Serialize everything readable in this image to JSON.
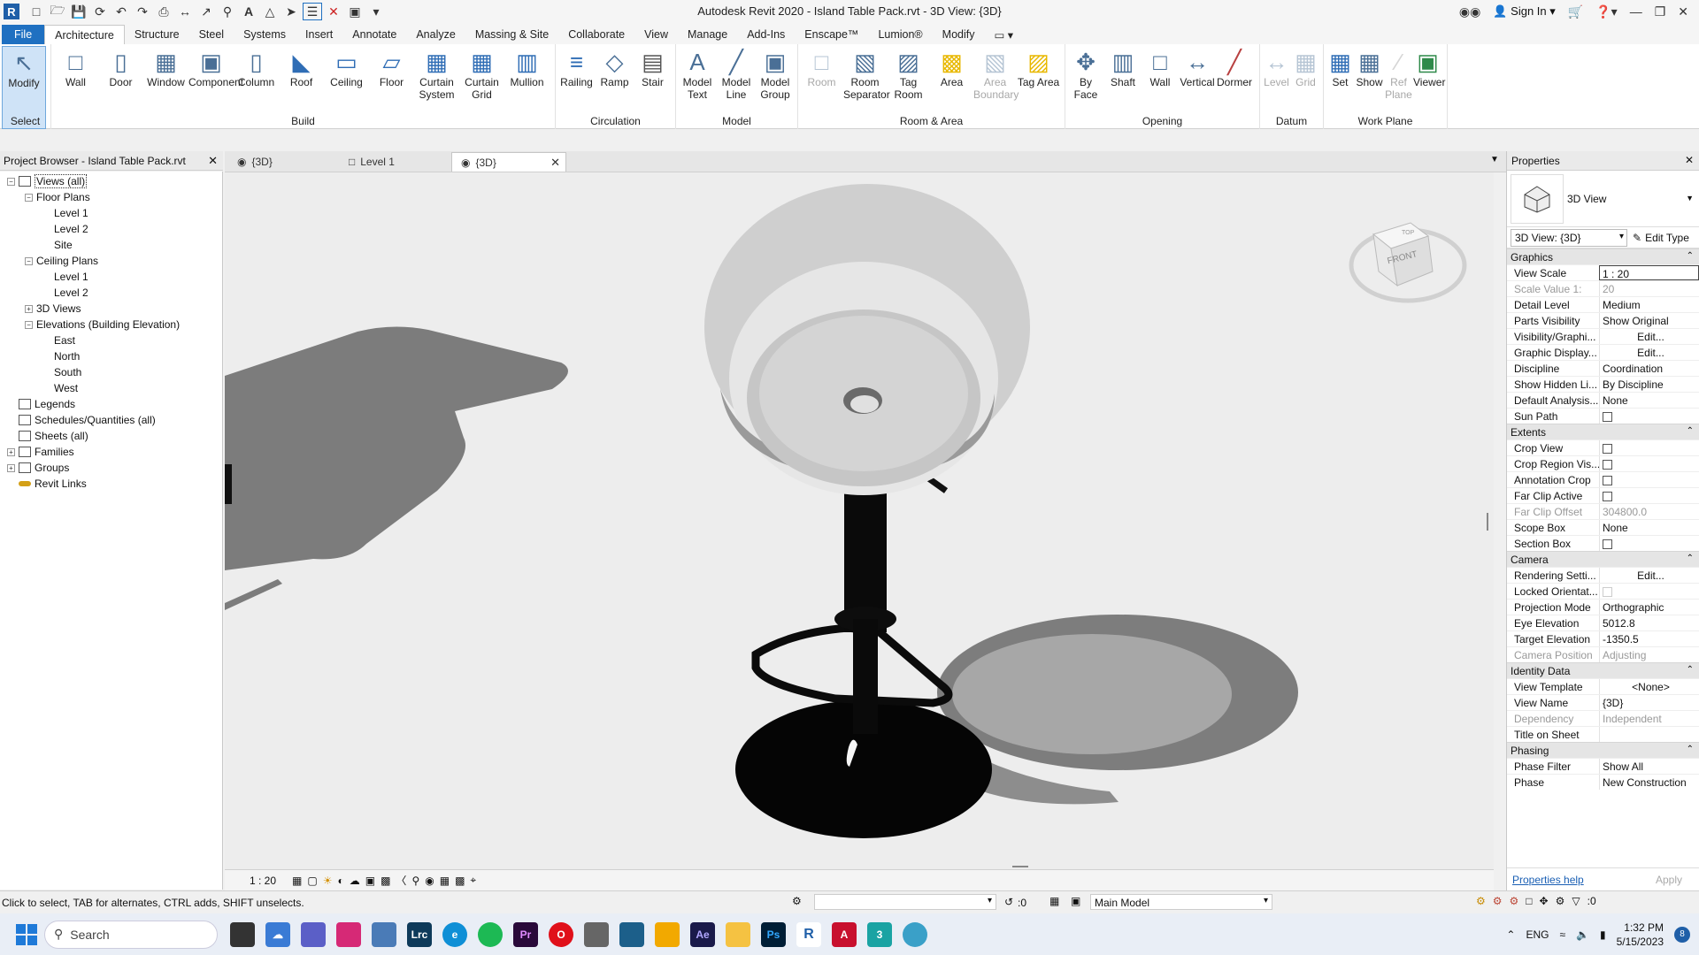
{
  "titlebar": {
    "title": "Autodesk Revit 2020 - Island Table Pack.rvt - 3D View: {3D}",
    "sign_in": "Sign In"
  },
  "menu": {
    "tabs": [
      "File",
      "Architecture",
      "Structure",
      "Steel",
      "Systems",
      "Insert",
      "Annotate",
      "Analyze",
      "Massing & Site",
      "Collaborate",
      "View",
      "Manage",
      "Add-Ins",
      "Enscape™",
      "Lumion®",
      "Modify"
    ]
  },
  "ribbon": {
    "select": {
      "title": "Select",
      "tools": [
        "Modify"
      ]
    },
    "build": {
      "title": "Build",
      "tools": [
        "Wall",
        "Door",
        "Window",
        "Component",
        "Column",
        "Roof",
        "Ceiling",
        "Floor",
        "Curtain System",
        "Curtain Grid",
        "Mullion"
      ]
    },
    "circulation": {
      "title": "Circulation",
      "tools": [
        "Railing",
        "Ramp",
        "Stair"
      ]
    },
    "model": {
      "title": "Model",
      "tools": [
        "Model Text",
        "Model Line",
        "Model Group"
      ]
    },
    "room_area": {
      "title": "Room & Area",
      "tools": [
        "Room",
        "Room Separator",
        "Tag Room",
        "Area",
        "Area Boundary",
        "Tag Area"
      ]
    },
    "opening": {
      "title": "Opening",
      "tools": [
        "By Face",
        "Shaft",
        "Wall",
        "Vertical",
        "Dormer"
      ]
    },
    "datum": {
      "title": "Datum",
      "tools": [
        "Level",
        "Grid"
      ]
    },
    "work_plane": {
      "title": "Work Plane",
      "tools": [
        "Set",
        "Show",
        "Ref Plane",
        "Viewer"
      ]
    }
  },
  "project_browser": {
    "title": "Project Browser - Island Table Pack.rvt",
    "items": [
      {
        "label": "Views (all)",
        "level": 0,
        "exp": "-"
      },
      {
        "label": "Floor Plans",
        "level": 1,
        "exp": "-"
      },
      {
        "label": "Level 1",
        "level": 2,
        "exp": ""
      },
      {
        "label": "Level 2",
        "level": 2,
        "exp": ""
      },
      {
        "label": "Site",
        "level": 2,
        "exp": ""
      },
      {
        "label": "Ceiling Plans",
        "level": 1,
        "exp": "-"
      },
      {
        "label": "Level 1",
        "level": 2,
        "exp": ""
      },
      {
        "label": "Level 2",
        "level": 2,
        "exp": ""
      },
      {
        "label": "3D Views",
        "level": 1,
        "exp": "+"
      },
      {
        "label": "Elevations (Building Elevation)",
        "level": 1,
        "exp": "-"
      },
      {
        "label": "East",
        "level": 2,
        "exp": ""
      },
      {
        "label": "North",
        "level": 2,
        "exp": ""
      },
      {
        "label": "South",
        "level": 2,
        "exp": ""
      },
      {
        "label": "West",
        "level": 2,
        "exp": ""
      },
      {
        "label": "Legends",
        "level": 0,
        "exp": ""
      },
      {
        "label": "Schedules/Quantities (all)",
        "level": 0,
        "exp": ""
      },
      {
        "label": "Sheets (all)",
        "level": 0,
        "exp": ""
      },
      {
        "label": "Families",
        "level": 0,
        "exp": "+"
      },
      {
        "label": "Groups",
        "level": 0,
        "exp": "+"
      },
      {
        "label": "Revit Links",
        "level": 0,
        "exp": ""
      }
    ]
  },
  "doc_tabs": [
    "{3D}",
    "Level 1",
    "{3D}"
  ],
  "viewcube": {
    "face": "FRONT",
    "top": "TOP"
  },
  "view_bar": {
    "scale": "1 : 20"
  },
  "properties": {
    "title": "Properties",
    "type_name": "3D View",
    "selector": "3D View: {3D}",
    "edit_type": "Edit Type",
    "groups": [
      {
        "name": "Graphics",
        "rows": [
          {
            "k": "View Scale",
            "v": "1 : 20",
            "style": "box"
          },
          {
            "k": "Scale Value    1:",
            "v": "20",
            "style": "dim"
          },
          {
            "k": "Detail Level",
            "v": "Medium"
          },
          {
            "k": "Parts Visibility",
            "v": "Show Original"
          },
          {
            "k": "Visibility/Graphi...",
            "v": "Edit...",
            "style": "btn"
          },
          {
            "k": "Graphic Display...",
            "v": "Edit...",
            "style": "btn"
          },
          {
            "k": "Discipline",
            "v": "Coordination"
          },
          {
            "k": "Show Hidden Li...",
            "v": "By Discipline"
          },
          {
            "k": "Default Analysis...",
            "v": "None"
          },
          {
            "k": "Sun Path",
            "v": "",
            "style": "cb"
          }
        ]
      },
      {
        "name": "Extents",
        "rows": [
          {
            "k": "Crop View",
            "v": "",
            "style": "cb"
          },
          {
            "k": "Crop Region Vis...",
            "v": "",
            "style": "cb"
          },
          {
            "k": "Annotation Crop",
            "v": "",
            "style": "cb"
          },
          {
            "k": "Far Clip Active",
            "v": "",
            "style": "cb"
          },
          {
            "k": "Far Clip Offset",
            "v": "304800.0",
            "style": "dim"
          },
          {
            "k": "Scope Box",
            "v": "None"
          },
          {
            "k": "Section Box",
            "v": "",
            "style": "cb"
          }
        ]
      },
      {
        "name": "Camera",
        "rows": [
          {
            "k": "Rendering Setti...",
            "v": "Edit...",
            "style": "btn"
          },
          {
            "k": "Locked Orientat...",
            "v": "",
            "style": "cbdim"
          },
          {
            "k": "Projection Mode",
            "v": "Orthographic"
          },
          {
            "k": "Eye Elevation",
            "v": "5012.8"
          },
          {
            "k": "Target Elevation",
            "v": "-1350.5"
          },
          {
            "k": "Camera Position",
            "v": "Adjusting",
            "style": "dim"
          }
        ]
      },
      {
        "name": "Identity Data",
        "rows": [
          {
            "k": "View Template",
            "v": "<None>",
            "style": "btn"
          },
          {
            "k": "View Name",
            "v": "{3D}"
          },
          {
            "k": "Dependency",
            "v": "Independent",
            "style": "dim"
          },
          {
            "k": "Title on Sheet",
            "v": ""
          }
        ]
      },
      {
        "name": "Phasing",
        "rows": [
          {
            "k": "Phase Filter",
            "v": "Show All"
          },
          {
            "k": "Phase",
            "v": "New Construction"
          }
        ]
      }
    ],
    "help": "Properties help",
    "apply": "Apply"
  },
  "status": {
    "hint": "Click to select, TAB for alternates, CTRL adds, SHIFT unselects.",
    "workset_count": ":0",
    "model": "Main Model",
    "filter_count": ":0"
  },
  "taskbar": {
    "search": "Search",
    "time": "1:32 PM",
    "date": "5/15/2023",
    "lang": "ENG",
    "badge": "8"
  }
}
